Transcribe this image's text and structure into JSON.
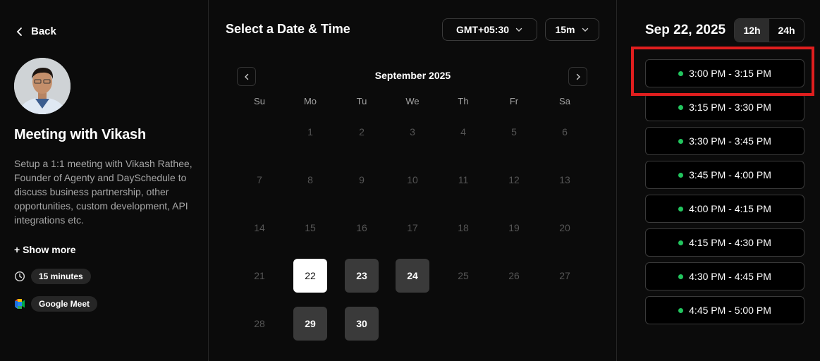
{
  "left": {
    "back_label": "Back",
    "title": "Meeting with Vikash",
    "description": "Setup a 1:1 meeting with Vikash Rathee, Founder of Agenty and DaySchedule to discuss business partnership, other opportunities, custom development, API integrations etc.",
    "show_more": "+ Show more",
    "duration": "15 minutes",
    "location": "Google Meet"
  },
  "calendar": {
    "heading": "Select a Date & Time",
    "timezone": "GMT+05:30",
    "duration_select": "15m",
    "month": "September 2025",
    "weekdays": [
      "Su",
      "Mo",
      "Tu",
      "We",
      "Th",
      "Fr",
      "Sa"
    ],
    "days": [
      "1",
      "2",
      "3",
      "4",
      "5",
      "6",
      "7",
      "8",
      "9",
      "10",
      "11",
      "12",
      "13",
      "14",
      "15",
      "16",
      "17",
      "18",
      "19",
      "20",
      "21",
      "22",
      "23",
      "24",
      "25",
      "26",
      "27",
      "28",
      "29",
      "30"
    ],
    "available_days": [
      "22",
      "23",
      "24",
      "29",
      "30"
    ],
    "selected_day": "22"
  },
  "slots": {
    "date": "Sep 22, 2025",
    "format_12h": "12h",
    "format_24h": "24h",
    "active_format": "12h",
    "times": [
      "3:00 PM - 3:15 PM",
      "3:15 PM - 3:30 PM",
      "3:30 PM - 3:45 PM",
      "3:45 PM - 4:00 PM",
      "4:00 PM - 4:15 PM",
      "4:15 PM - 4:30 PM",
      "4:30 PM - 4:45 PM",
      "4:45 PM - 5:00 PM"
    ]
  },
  "colors": {
    "available_dot": "#22c55e",
    "highlight": "#e01e1e"
  }
}
